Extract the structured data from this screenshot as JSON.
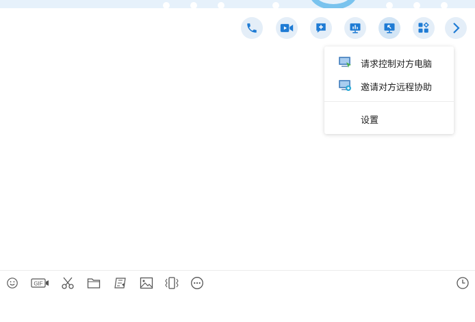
{
  "toolbar": {
    "buttons": [
      {
        "name": "phone-icon"
      },
      {
        "name": "video-icon"
      },
      {
        "name": "add-chat-icon"
      },
      {
        "name": "screen-share-icon"
      },
      {
        "name": "remote-assist-icon"
      },
      {
        "name": "apps-icon"
      },
      {
        "name": "chevron-right-icon"
      }
    ],
    "accent_color": "#1e7bd4",
    "button_bg_color": "#e4eef8"
  },
  "remote_menu": {
    "items": [
      {
        "label": "请求控制对方电脑",
        "icon": "remote-control-icon"
      },
      {
        "label": "邀请对方远程协助",
        "icon": "remote-assist-invite-icon"
      },
      {
        "label": "设置"
      }
    ]
  },
  "input_toolbar": {
    "tools": [
      {
        "name": "emoji-icon"
      },
      {
        "name": "gif-icon",
        "text": "GIF"
      },
      {
        "name": "scissors-icon"
      },
      {
        "name": "folder-icon"
      },
      {
        "name": "sticker-icon"
      },
      {
        "name": "image-icon"
      },
      {
        "name": "shake-icon"
      },
      {
        "name": "more-icon"
      }
    ],
    "history": {
      "name": "clock-icon"
    }
  }
}
